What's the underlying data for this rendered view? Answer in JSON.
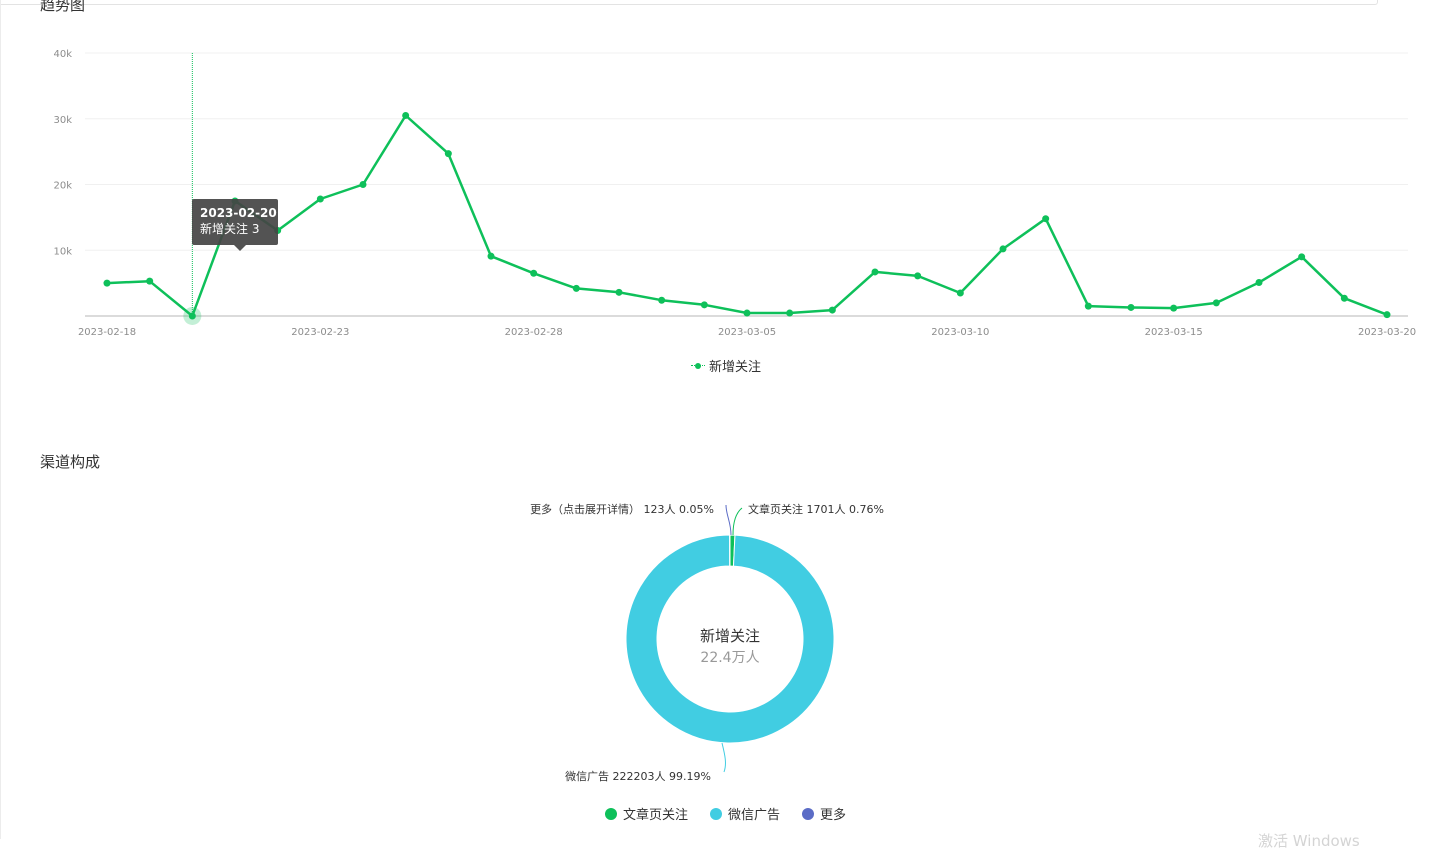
{
  "trend": {
    "title": "趋势图",
    "legend_label": "新增关注",
    "tooltip": {
      "date": "2023-02-20",
      "text": "新增关注 3"
    }
  },
  "channel": {
    "title": "渠道构成",
    "center_label": "新增关注",
    "center_value": "22.4万人",
    "labels": {
      "more": "更多（点击展开详情） 123人 0.05%",
      "article": "文章页关注 1701人 0.76%",
      "wechat": "微信广告 222203人 99.19%"
    },
    "legend": [
      {
        "name": "文章页关注",
        "color": "#0ec05a"
      },
      {
        "name": "微信广告",
        "color": "#41cde2"
      },
      {
        "name": "更多",
        "color": "#5b6cc6"
      }
    ]
  },
  "watermark": "激活 Windows",
  "chart_data": [
    {
      "type": "line",
      "title": "趋势图",
      "x": [
        "2023-02-18",
        "2023-02-19",
        "2023-02-20",
        "2023-02-21",
        "2023-02-22",
        "2023-02-23",
        "2023-02-24",
        "2023-02-25",
        "2023-02-26",
        "2023-02-27",
        "2023-02-28",
        "2023-03-01",
        "2023-03-02",
        "2023-03-03",
        "2023-03-04",
        "2023-03-05",
        "2023-03-06",
        "2023-03-07",
        "2023-03-08",
        "2023-03-09",
        "2023-03-10",
        "2023-03-11",
        "2023-03-12",
        "2023-03-13",
        "2023-03-14",
        "2023-03-15",
        "2023-03-16",
        "2023-03-17",
        "2023-03-18",
        "2023-03-19",
        "2023-03-20"
      ],
      "x_tick_labels": [
        "2023-02-18",
        "2023-02-23",
        "2023-02-28",
        "2023-03-05",
        "2023-03-10",
        "2023-03-15",
        "2023-03-20"
      ],
      "series": [
        {
          "name": "新增关注",
          "color": "#0ec05a",
          "values": [
            5000,
            5300,
            3,
            17500,
            13000,
            17800,
            20000,
            30500,
            24700,
            9100,
            6500,
            4200,
            3600,
            2400,
            1700,
            450,
            450,
            900,
            6700,
            6100,
            3500,
            10200,
            14800,
            1500,
            1300,
            1200,
            2000,
            5100,
            9000,
            2700,
            200
          ]
        }
      ],
      "ylim": [
        0,
        40000
      ],
      "y_tick_labels": [
        "10k",
        "20k",
        "30k",
        "40k"
      ],
      "grid": true,
      "legend": "bottom-center"
    },
    {
      "type": "pie",
      "title": "渠道构成",
      "categories": [
        "文章页关注",
        "微信广告",
        "更多"
      ],
      "values": [
        1701,
        222203,
        123
      ],
      "percentages": [
        0.76,
        99.19,
        0.05
      ],
      "colors": [
        "#0ec05a",
        "#41cde2",
        "#5b6cc6"
      ],
      "legend": "bottom-center"
    }
  ]
}
